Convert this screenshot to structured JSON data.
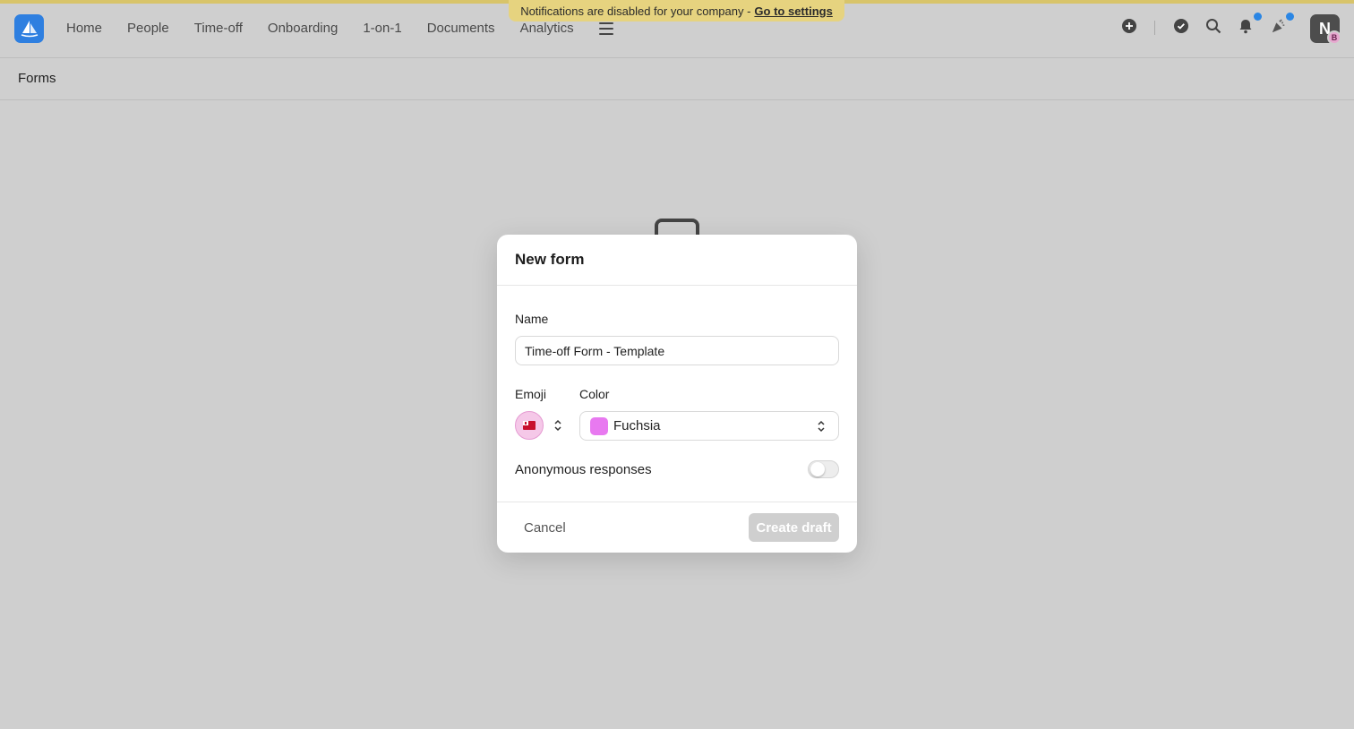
{
  "banner": {
    "text": "Notifications are disabled for your company - ",
    "link": "Go to settings"
  },
  "nav": {
    "items": [
      "Home",
      "People",
      "Time-off",
      "Onboarding",
      "1-on-1",
      "Documents",
      "Analytics"
    ]
  },
  "user": {
    "initial": "N",
    "badge": "B"
  },
  "subbar": {
    "title": "Forms"
  },
  "modal": {
    "title": "New form",
    "name_label": "Name",
    "name_value": "Time-off Form - Template",
    "emoji_label": "Emoji",
    "color_label": "Color",
    "color_value": "Fuchsia",
    "color_hex": "#e879f0",
    "anonymous_label": "Anonymous responses",
    "anonymous_enabled": false,
    "cancel_label": "Cancel",
    "create_label": "Create draft"
  },
  "icons": [
    "plus-circle-icon",
    "check-circle-icon",
    "search-icon",
    "bell-icon",
    "party-icon",
    "menu-icon",
    "flag-emoji-icon"
  ],
  "colors": {
    "accent": "#2e7fe0",
    "banner": "#e6d37f",
    "dot": "#2b86e4"
  }
}
